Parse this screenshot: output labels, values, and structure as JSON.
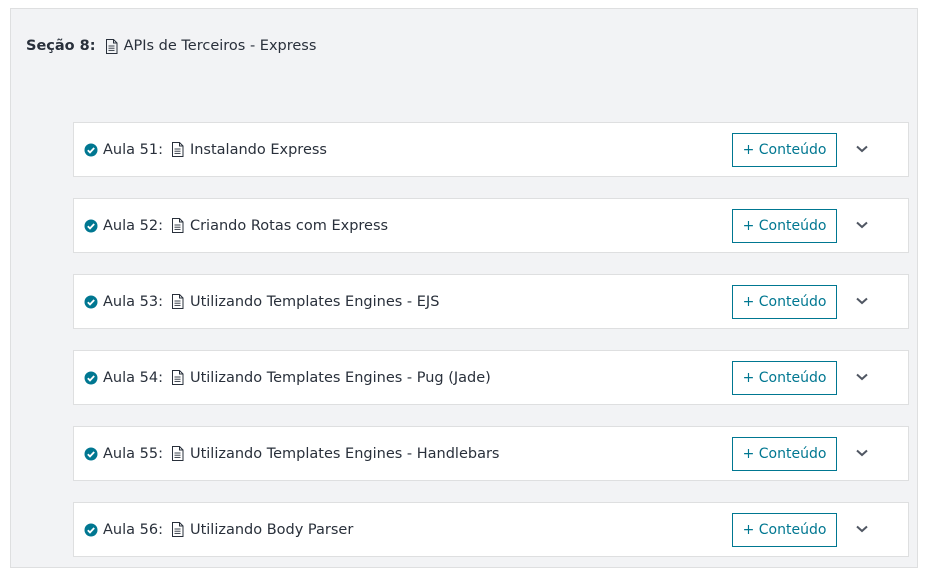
{
  "section": {
    "label": "Seção 8:",
    "title": "APIs de Terceiros - Express",
    "icon": "document-icon"
  },
  "accent_color": "#007791",
  "lectures": [
    {
      "number": "Aula 51:",
      "title": "Instalando Express",
      "button": "+ Conteúdo",
      "status_icon": "check-circle-icon"
    },
    {
      "number": "Aula 52:",
      "title": "Criando Rotas com Express",
      "button": "+ Conteúdo",
      "status_icon": "check-circle-icon"
    },
    {
      "number": "Aula 53:",
      "title": "Utilizando Templates Engines - EJS",
      "button": "+ Conteúdo",
      "status_icon": "check-circle-icon"
    },
    {
      "number": "Aula 54:",
      "title": "Utilizando Templates Engines - Pug (Jade)",
      "button": "+ Conteúdo",
      "status_icon": "check-circle-icon"
    },
    {
      "number": "Aula 55:",
      "title": "Utilizando Templates Engines - Handlebars",
      "button": "+ Conteúdo",
      "status_icon": "check-circle-icon"
    },
    {
      "number": "Aula 56:",
      "title": "Utilizando Body Parser",
      "button": "+ Conteúdo",
      "status_icon": "check-circle-icon"
    }
  ]
}
